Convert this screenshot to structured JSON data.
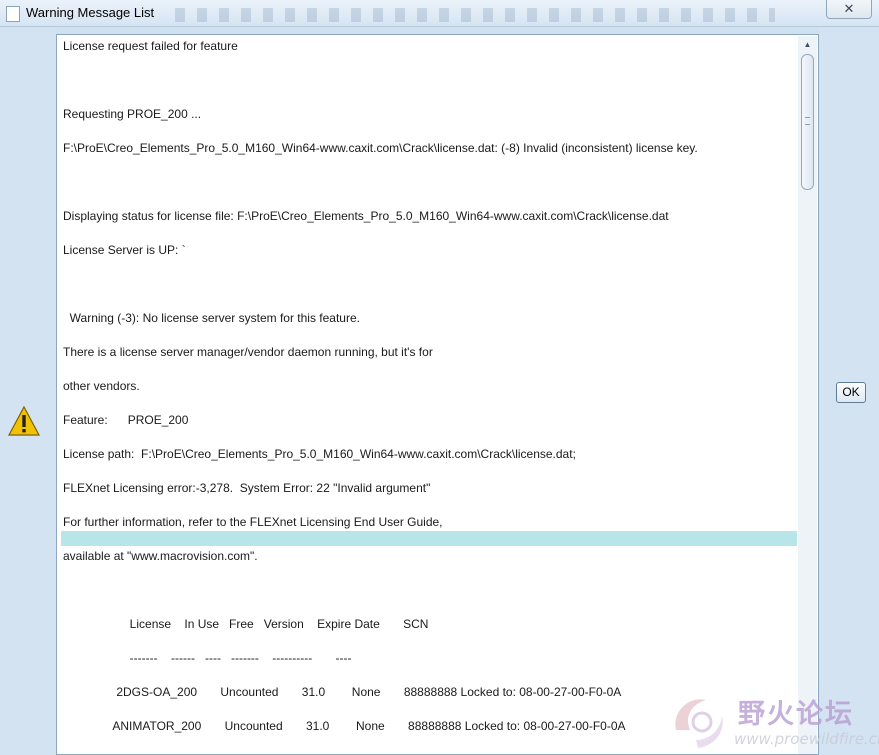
{
  "window": {
    "title": "Warning Message List",
    "close_glyph": "✕"
  },
  "messages": [
    "License request failed for feature",
    "",
    "Requesting PROE_200 ...",
    "F:\\ProE\\Creo_Elements_Pro_5.0_M160_Win64-www.caxit.com\\Crack\\license.dat: (-8) Invalid (inconsistent) license key.",
    "",
    "Displaying status for license file: F:\\ProE\\Creo_Elements_Pro_5.0_M160_Win64-www.caxit.com\\Crack\\license.dat",
    "License Server is UP: `",
    "",
    "  Warning (-3): No license server system for this feature.",
    "There is a license server manager/vendor daemon running, but it's for",
    "other vendors.",
    "Feature:      PROE_200",
    "License path:  F:\\ProE\\Creo_Elements_Pro_5.0_M160_Win64-www.caxit.com\\Crack\\license.dat;",
    "FLEXnet Licensing error:-3,278.  System Error: 22 \"Invalid argument\"",
    "For further information, refer to the FLEXnet Licensing End User Guide,",
    "available at \"www.macrovision.com\".",
    "",
    "                    License    In Use   Free   Version    Expire Date       SCN",
    "                    -------    ------   ----   -------    ----------       ----",
    "                2DGS-OA_200       Uncounted       31.0        None       88888888 Locked to: 08-00-27-00-F0-0A",
    "               ANIMATOR_200       Uncounted       31.0        None       88888888 Locked to: 08-00-27-00-F0-0A"
  ],
  "buttons": {
    "ok": "OK"
  },
  "icons": {
    "warning": "warning-icon",
    "scroll_up": "▲"
  },
  "watermark": {
    "text": "野火论坛",
    "url": "www.proewildfire.cn"
  },
  "colors": {
    "highlight_row": "#b7e5e8",
    "frame_bg": "#d3e3f1"
  }
}
